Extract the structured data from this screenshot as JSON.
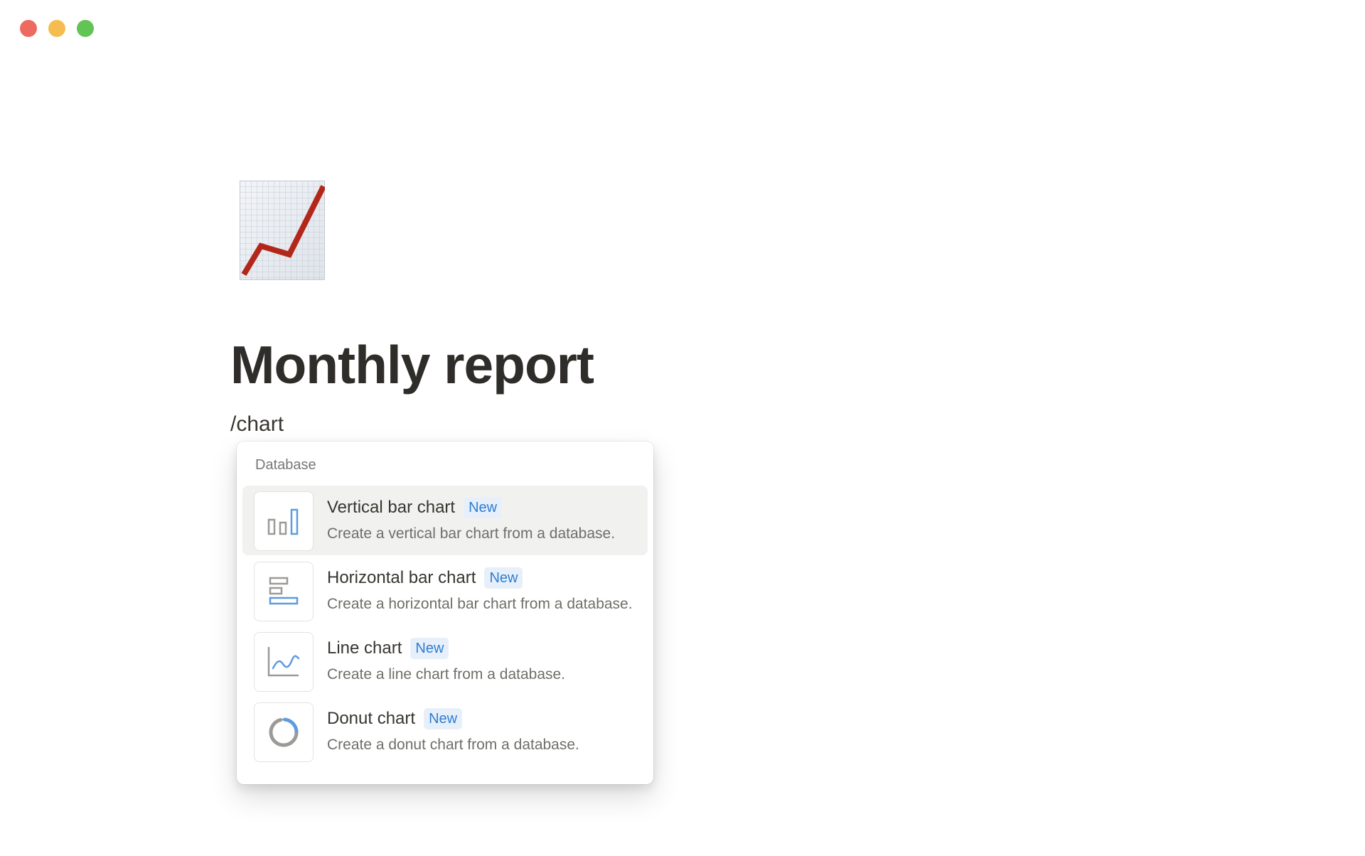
{
  "page": {
    "title": "Monthly report",
    "slash_command": "/chart",
    "icon": "chart-increasing-icon"
  },
  "window_controls": [
    "close-button",
    "minimize-button",
    "maximize-button"
  ],
  "menu": {
    "section_label": "Database",
    "items": [
      {
        "title": "Vertical bar chart",
        "badge": "New",
        "description": "Create a vertical bar chart from a database.",
        "icon": "vertical-bar-chart-icon",
        "active": true
      },
      {
        "title": "Horizontal bar chart",
        "badge": "New",
        "description": "Create a horizontal bar chart from a database.",
        "icon": "horizontal-bar-chart-icon",
        "active": false
      },
      {
        "title": "Line chart",
        "badge": "New",
        "description": "Create a line chart from a database.",
        "icon": "line-chart-icon",
        "active": false
      },
      {
        "title": "Donut chart",
        "badge": "New",
        "description": "Create a donut chart from a database.",
        "icon": "donut-chart-icon",
        "active": false
      }
    ]
  },
  "colors": {
    "accent": "#2e7cd1",
    "badge_bg": "#e7f0fa",
    "chart_line": "#b3271b",
    "active_item_bg": "#f1f1ef"
  }
}
